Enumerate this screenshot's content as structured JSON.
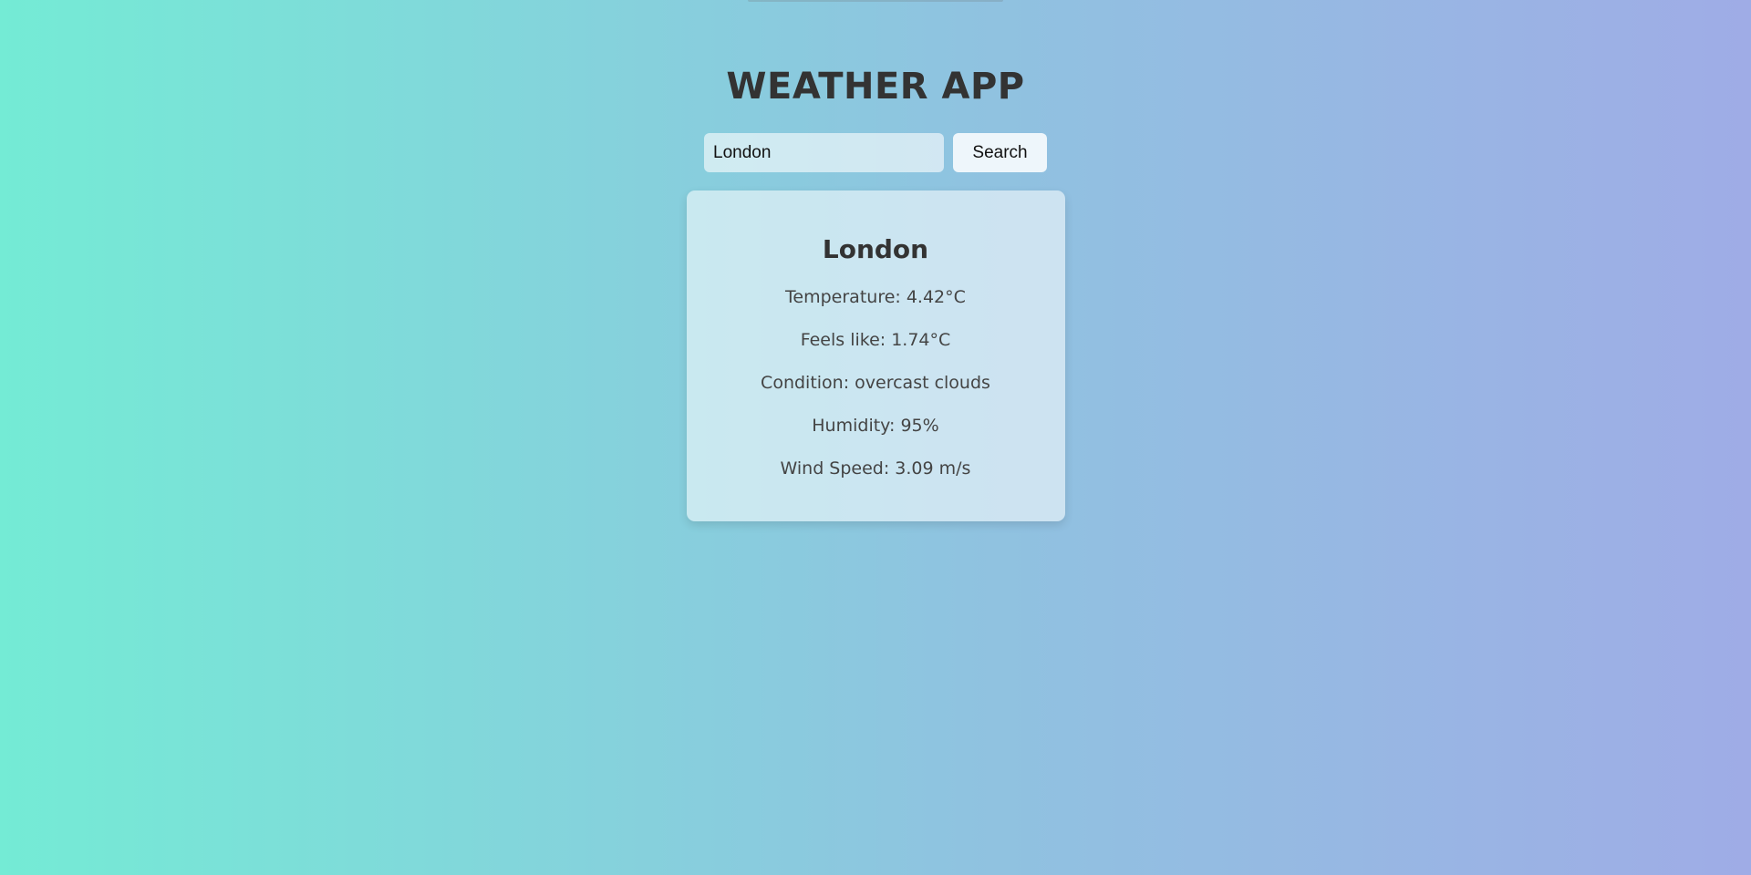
{
  "app": {
    "title": "WEATHER APP"
  },
  "search": {
    "value": "London",
    "button_label": "Search"
  },
  "weather": {
    "city": "London",
    "temperature": "Temperature: 4.42°C",
    "feels_like": "Feels like: 1.74°C",
    "condition": "Condition: overcast clouds",
    "humidity": "Humidity: 95%",
    "wind_speed": "Wind Speed: 3.09 m/s"
  },
  "colors": {
    "gradient_start": "#74ebd5",
    "gradient_end": "#9face6",
    "text": "#333333"
  }
}
